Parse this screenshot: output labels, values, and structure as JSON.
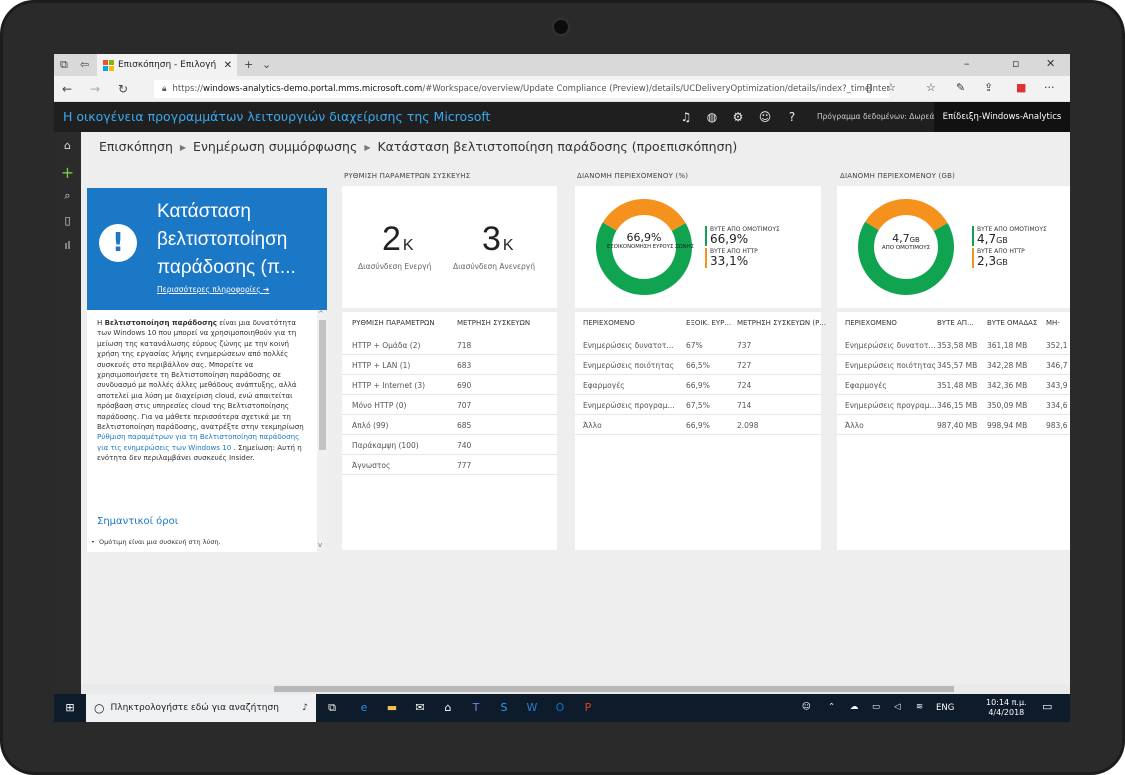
{
  "browser": {
    "tab_title": "Επισκόπηση - Επιλογή",
    "url_prefix": "https://",
    "url_domain": "windows-analytics-demo.portal.mms.microsoft.com",
    "url_rest": "/#Workspace/overview/Update Compliance (Preview)/details/UCDeliveryOptimization/details/index?_timeInterval.inte",
    "controls": {
      "minimize": "–",
      "restore": "▫",
      "close": "✕"
    }
  },
  "portal": {
    "title": "Η οικογένεια προγραμμάτων λειτουργιών διαχείρισης της Microsoft",
    "data_plan": "Πρόγραμμα δεδομένων: Δωρεάν",
    "tenant": "Επίδειξη-Windows-Analytics"
  },
  "breadcrumb": {
    "item1": "Επισκόπηση",
    "item2": "Ενημέρωση συμμόρφωσης",
    "item3": "Κατάσταση βελτιστοποίηση παράδοσης (προεπισκόπηση)"
  },
  "overview": {
    "tile_title": "Κατάσταση βελτιστοποίηση παράδοσης (π...",
    "more_info": "Περισσότερες πληροφορίες",
    "desc_p1": "Η ",
    "desc_bold": "Βελτιστοποίηση παράδοσης",
    "desc_p2": " είναι μια δυνατότητα των Windows 10 που μπορεί να χρησιμοποιηθούν για τη μείωση της κατανάλωσης εύρους ζώνης με την κοινή χρήση της εργασίας λήψης ενημερώσεων από πολλές συσκευές στο περιβάλλον σας. Μπορείτε να χρησιμοποιήσετε τη Βελτιστοποίηση παράδοσης σε συνδυασμό με πολλές άλλες μεθόδους ανάπτυξης, αλλά αποτελεί μια λύση με διαχείριση cloud, ενώ απαιτείται πρόσβαση στις υπηρεσίες cloud της Βελτιστοποίησης παράδοσης. Για να μάθετε περισσότερα σχετικά με τη Βελτιστοποίηση παράδοσης, ανατρέξτε στην τεκμηρίωση ",
    "desc_link": "Ρύθμιση παραμέτρων για τη Βελτιστοποίηση παράδοσης για τις ενημερώσεις των Windows 10",
    "desc_p3": " . Σημείωση: Αυτή η ενότητα δεν περιλαμβάνει συσκευές Insider.",
    "section_heading": "Σημαντικοί όροι",
    "bullet": "Ομότιμη είναι μια συσκευή στη λύση."
  },
  "config_card": {
    "header": "ΡΥΘΜΙΣΗ ΠΑΡΑΜΕΤΡΩΝ ΣΥΣΚΕΥΗΣ",
    "active_value": "2",
    "active_unit": "Κ",
    "active_label": "Διασύνδεση Ενεργή",
    "inactive_value": "3",
    "inactive_unit": "Κ",
    "inactive_label": "Διασύνδεση Ανενεργή",
    "col1": "ΡΥΘΜΙΣΗ ΠΑΡΑΜΕΤΡΩΝ",
    "col2": "ΜΕΤΡΗΣΗ ΣΥΣΚΕΥΩΝ",
    "rows": [
      {
        "name": "HTTP + Ομάδα (2)",
        "count": "718"
      },
      {
        "name": "HTTP + LAN (1)",
        "count": "683"
      },
      {
        "name": "HTTP + Internet (3)",
        "count": "690"
      },
      {
        "name": "Μόνο HTTP (0)",
        "count": "707"
      },
      {
        "name": "Απλό (99)",
        "count": "685"
      },
      {
        "name": "Παράκαμψη (100)",
        "count": "740"
      },
      {
        "name": "Άγνωστος",
        "count": "777"
      }
    ]
  },
  "pct_card": {
    "header": "ΔΙΑΝΟΜΗ ΠΕΡΙΕΧΟΜΕΝΟΥ (%)",
    "center_value": "66,9%",
    "center_label": "ΕΞΟΙΚΟΝΟΜΗΣΗ ΕΥΡΟΥΣ ΖΩΝΗΣ",
    "legend1_label": "ΒΥΤΕ ΑΠΟ ΟΜΟΤΙΜΟΥΣ",
    "legend1_value": "66,9%",
    "legend2_label": "ΒΥΤΕ ΑΠΟ HTTP",
    "legend2_value": "33,1%",
    "col1": "ΠΕΡΙΕΧΟΜΕΝΟ",
    "col2": "ΕΞΟΙΚ. ΕΥΡ...",
    "col3": "ΜΕΤΡΗΣΗ ΣΥΣΚΕΥΩΝ (Ρ...",
    "rows": [
      {
        "name": "Ενημερώσεις δυνατοτ...",
        "pct": "67%",
        "count": "737"
      },
      {
        "name": "Ενημερώσεις ποιότητας",
        "pct": "66,5%",
        "count": "727"
      },
      {
        "name": "Εφαρμογές",
        "pct": "66,9%",
        "count": "724"
      },
      {
        "name": "Ενημερώσεις προγραμ...",
        "pct": "67,5%",
        "count": "714"
      },
      {
        "name": "Άλλο",
        "pct": "66,9%",
        "count": "2.098"
      }
    ]
  },
  "gb_card": {
    "header": "ΔΙΑΝΟΜΗ ΠΕΡΙΕΧΟΜΕΝΟΥ (GB)",
    "center_value": "4,7",
    "center_unit": "GB",
    "center_label": "ΑΠΟ ΟΜΟΤΙΜΟΥΣ",
    "legend1_label": "ΒΥΤΕ ΑΠΟ ΟΜΟΤΙΜΟΥΣ",
    "legend1_value": "4,7",
    "legend1_unit": "GB",
    "legend2_label": "ΒΥΤΕ ΑΠΟ HTTP",
    "legend2_value": "2,3",
    "legend2_unit": "GB",
    "col1": "ΠΕΡΙΕΧΟΜΕΝΟ",
    "col2": "ΒΥΤΕ ΑΠ...",
    "col3": "ΒΥΤΕ ΟΜΑΔΑΣ",
    "col4": "ΜΗ-",
    "rows": [
      {
        "name": "Ενημερώσεις δυνατοτ...",
        "a": "353,58 MB",
        "b": "361,18 MB",
        "c": "352,1"
      },
      {
        "name": "Ενημερώσεις ποιότητας",
        "a": "345,57 MB",
        "b": "342,28 MB",
        "c": "346,7"
      },
      {
        "name": "Εφαρμογές",
        "a": "351,48 MB",
        "b": "342,36 MB",
        "c": "343,9"
      },
      {
        "name": "Ενημερώσεις προγραμ...",
        "a": "346,15 MB",
        "b": "350,09 MB",
        "c": "334,6"
      },
      {
        "name": "Άλλο",
        "a": "987,40 MB",
        "b": "998,94 MB",
        "c": "983,6"
      }
    ]
  },
  "chart_data": [
    {
      "type": "pie",
      "categories": [
        "ΒΥΤΕ ΑΠΟ ΟΜΟΤΙΜΟΥΣ",
        "ΒΥΤΕ ΑΠΟ HTTP"
      ],
      "values": [
        66.9,
        33.1
      ],
      "colors": [
        "#10a350",
        "#f5921e"
      ]
    },
    {
      "type": "pie",
      "categories": [
        "ΒΥΤΕ ΑΠΟ ΟΜΟΤΙΜΟΥΣ",
        "ΒΥΤΕ ΑΠΟ HTTP"
      ],
      "values": [
        4.7,
        2.3
      ],
      "colors": [
        "#10a350",
        "#f5921e"
      ]
    }
  ],
  "taskbar": {
    "search_placeholder": "Πληκτρολογήστε εδώ για αναζήτηση",
    "lang": "ENG",
    "time": "10:14 π.μ.",
    "date": "4/4/2018"
  }
}
